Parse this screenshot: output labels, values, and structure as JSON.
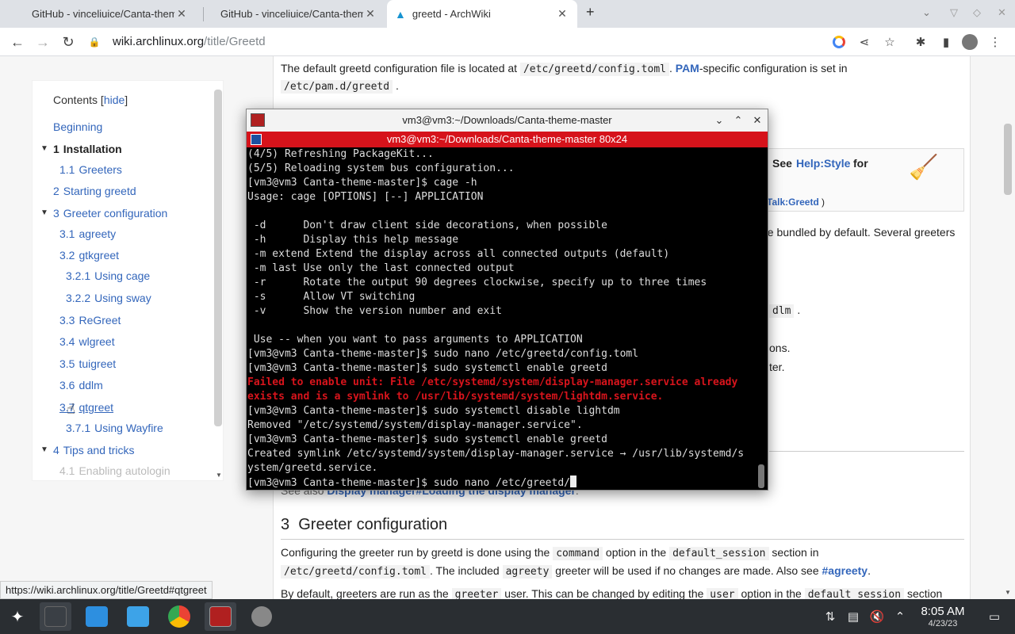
{
  "browser": {
    "tabs": [
      {
        "title": "GitHub - vinceliuice/Canta-theme",
        "active": false
      },
      {
        "title": "GitHub - vinceliuice/Canta-theme",
        "active": false
      },
      {
        "title": "greetd - ArchWiki",
        "active": true
      }
    ],
    "new_tab": "+",
    "url_domain": "wiki.archlinux.org",
    "url_path": "/title/Greetd",
    "status_url": "https://wiki.archlinux.org/title/Greetd#qtgreet"
  },
  "toc": {
    "heading": "Contents",
    "hide_label": "hide",
    "items": [
      {
        "num": "",
        "label": "Beginning"
      },
      {
        "num": "1",
        "label": "Installation"
      },
      {
        "num": "1.1",
        "label": "Greeters"
      },
      {
        "num": "2",
        "label": "Starting greetd"
      },
      {
        "num": "3",
        "label": "Greeter configuration"
      },
      {
        "num": "3.1",
        "label": "agreety"
      },
      {
        "num": "3.2",
        "label": "gtkgreet"
      },
      {
        "num": "3.2.1",
        "label": "Using cage"
      },
      {
        "num": "3.2.2",
        "label": "Using sway"
      },
      {
        "num": "3.3",
        "label": "ReGreet"
      },
      {
        "num": "3.4",
        "label": "wlgreet"
      },
      {
        "num": "3.5",
        "label": "tuigreet"
      },
      {
        "num": "3.6",
        "label": "ddlm"
      },
      {
        "num": "3.7",
        "label": "qtgreet"
      },
      {
        "num": "3.7.1",
        "label": "Using Wayfire"
      },
      {
        "num": "4",
        "label": "Tips and tricks"
      },
      {
        "num": "4.1",
        "label": "Enabling autologin"
      }
    ]
  },
  "article": {
    "p1_a": "The default greetd configuration file is located at",
    "p1_code1": "/etc/greetd/config.toml",
    "p1_link": "PAM",
    "p1_b": "-specific configuration is set in",
    "p1_code2": "/etc/pam.d/greetd",
    "note_see": "See",
    "note_link": "Help:Style",
    "note_for": "for",
    "note_talk": "Talk:Greetd",
    "frag_bundled": "ne bundled by default. Several greeters",
    "frag_dlm": "dlm",
    "frag_ons": "ons.",
    "frag_ter": "ter.",
    "see_also_prefix": "See also",
    "see_also_link": "Display manager#Loading the display manager",
    "h3_num": "3",
    "h3_title": "Greeter configuration",
    "p2_a": "Configuring the greeter run by greetd is done using the",
    "p2_code1": "command",
    "p2_b": "option in the",
    "p2_code2": "default_session",
    "p2_c": "section in",
    "p3_code1": "/etc/greetd/config.toml",
    "p3_a": ". The included",
    "p3_code2": "agreety",
    "p3_b": "greeter will be used if no changes are made. Also see",
    "p3_link": "#agreety",
    "p4_a": "By default, greeters are run as the",
    "p4_code1": "greeter",
    "p4_b": "user. This can be changed by editing the",
    "p4_code2": "user",
    "p4_c": "option in the",
    "p4_code3": "default_session",
    "p4_d": "section"
  },
  "terminal": {
    "window_title": "vm3@vm3:~/Downloads/Canta-theme-master",
    "tab_title": "vm3@vm3:~/Downloads/Canta-theme-master 80x24",
    "lines": [
      {
        "text": "(4/5) Refreshing PackageKit...",
        "err": false
      },
      {
        "text": "(5/5) Reloading system bus configuration...",
        "err": false
      },
      {
        "text": "[vm3@vm3 Canta-theme-master]$ cage -h",
        "err": false
      },
      {
        "text": "Usage: cage [OPTIONS] [--] APPLICATION",
        "err": false
      },
      {
        "text": "",
        "err": false
      },
      {
        "text": " -d      Don't draw client side decorations, when possible",
        "err": false
      },
      {
        "text": " -h      Display this help message",
        "err": false
      },
      {
        "text": " -m extend Extend the display across all connected outputs (default)",
        "err": false
      },
      {
        "text": " -m last Use only the last connected output",
        "err": false
      },
      {
        "text": " -r      Rotate the output 90 degrees clockwise, specify up to three times",
        "err": false
      },
      {
        "text": " -s      Allow VT switching",
        "err": false
      },
      {
        "text": " -v      Show the version number and exit",
        "err": false
      },
      {
        "text": "",
        "err": false
      },
      {
        "text": " Use -- when you want to pass arguments to APPLICATION",
        "err": false
      },
      {
        "text": "[vm3@vm3 Canta-theme-master]$ sudo nano /etc/greetd/config.toml",
        "err": false
      },
      {
        "text": "[vm3@vm3 Canta-theme-master]$ sudo systemctl enable greetd",
        "err": false
      },
      {
        "text": "Failed to enable unit: File /etc/systemd/system/display-manager.service already",
        "err": true
      },
      {
        "text": "exists and is a symlink to /usr/lib/systemd/system/lightdm.service.",
        "err": true
      },
      {
        "text": "[vm3@vm3 Canta-theme-master]$ sudo systemctl disable lightdm",
        "err": false
      },
      {
        "text": "Removed \"/etc/systemd/system/display-manager.service\".",
        "err": false
      },
      {
        "text": "[vm3@vm3 Canta-theme-master]$ sudo systemctl enable greetd",
        "err": false
      },
      {
        "text": "Created symlink /etc/systemd/system/display-manager.service → /usr/lib/systemd/s",
        "err": false
      },
      {
        "text": "ystem/greetd.service.",
        "err": false
      }
    ],
    "prompt_line": "[vm3@vm3 Canta-theme-master]$ sudo nano /etc/greetd/"
  },
  "taskbar": {
    "time": "8:05 AM",
    "date": "4/23/23"
  },
  "colors": {
    "terminal_accent": "#d6131b",
    "link": "#3366bb",
    "taskbar": "#2a2e32"
  }
}
